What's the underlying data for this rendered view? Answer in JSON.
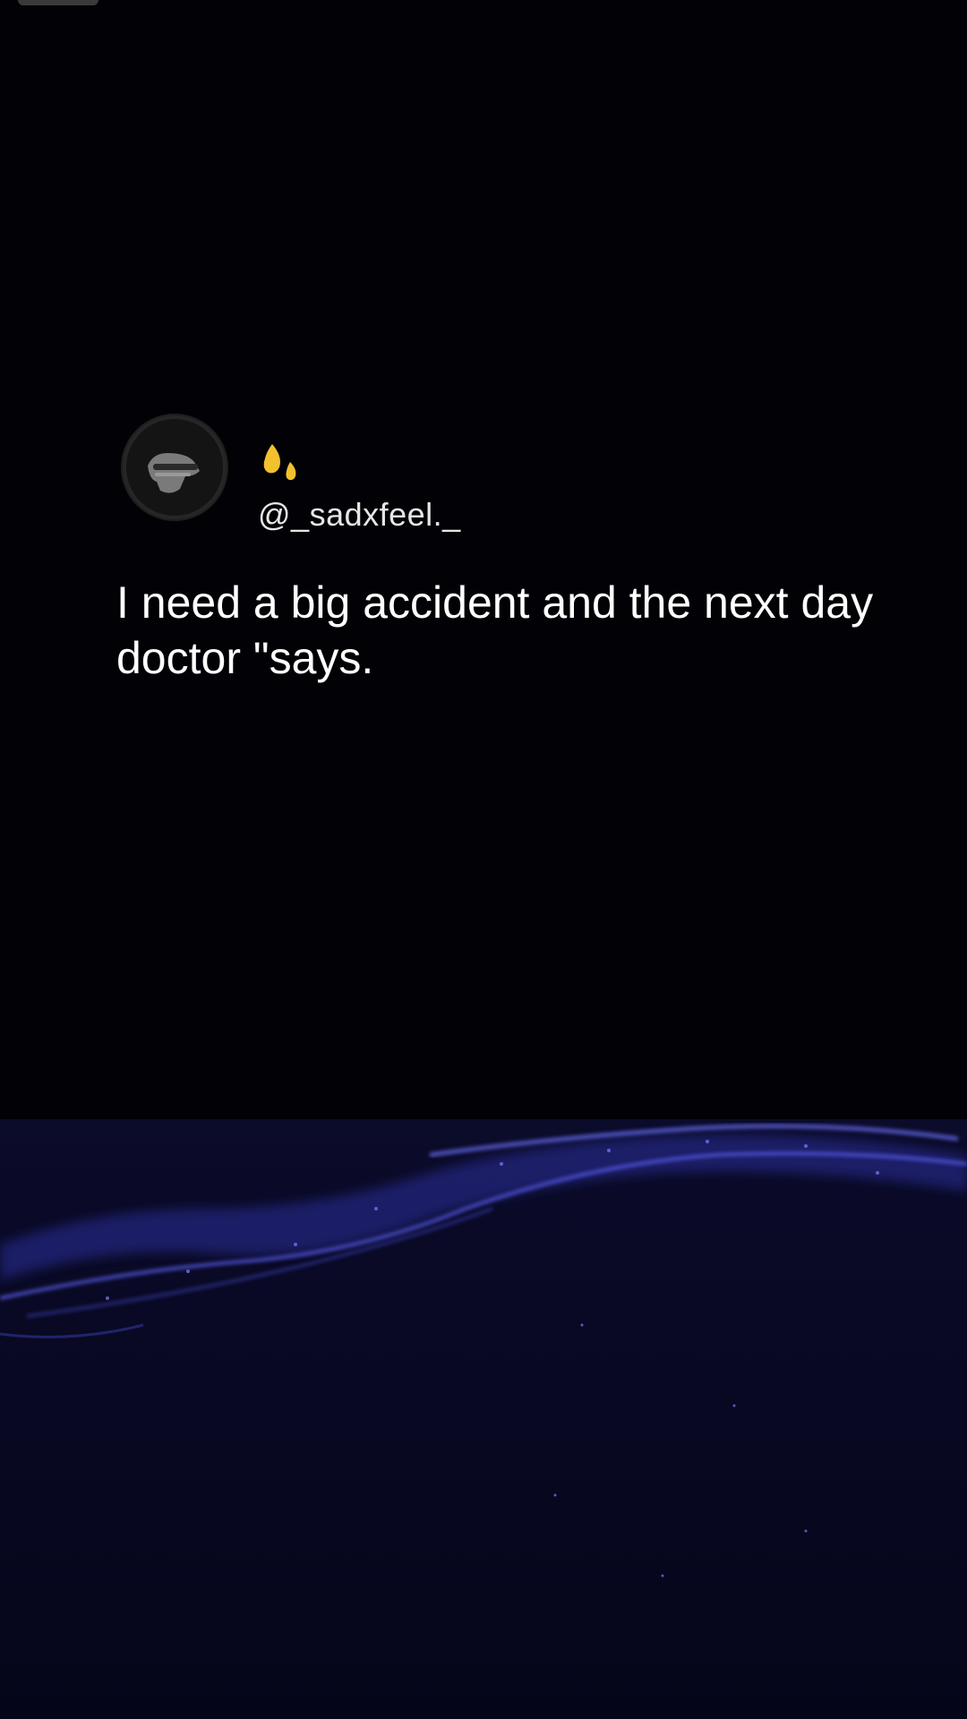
{
  "post": {
    "handle": "@_sadxfeel._",
    "text": "I need a big accident and the next day doctor \"says.",
    "avatar_icon": "masked-figure-avatar",
    "emoji_icon": "sweat-droplets-icon"
  },
  "colors": {
    "background": "#020206",
    "text": "#ffffff",
    "handle": "#e6e6e6",
    "emoji": "#f2c12e",
    "wave_glow": "#4b4fd8"
  }
}
